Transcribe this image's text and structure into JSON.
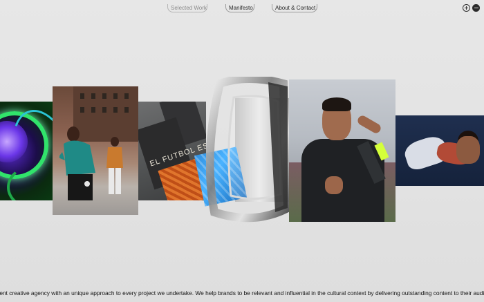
{
  "nav": {
    "items": [
      {
        "label": "Selected Work"
      },
      {
        "label": "Manifesto"
      },
      {
        "label": "About & Contact"
      }
    ]
  },
  "controls": {
    "zoom_in_icon": "plus-circle-icon",
    "zoom_out_icon": "minus-circle-icon"
  },
  "tiles": [
    {
      "name": "green-orb-artwork"
    },
    {
      "name": "street-fashion-photo"
    },
    {
      "name": "el-futbol-books"
    },
    {
      "name": "glass-ring-object"
    },
    {
      "name": "footballer-portrait"
    },
    {
      "name": "couple-on-floor-photo"
    }
  ],
  "books": {
    "cover_text": "EL FUTBOL ES DE LOS VALIENTES"
  },
  "footer": {
    "marquee_text": "ndent creative agency with an unique approach to every project we undertake. We help brands to be relevant and influential in the cultural context by delivering outstanding content to their audiences. We"
  },
  "colors": {
    "background": "#e4e4e4",
    "text": "#111111",
    "nav_border": "#9a9a9a",
    "accent_neon": "#d4ff3a"
  }
}
